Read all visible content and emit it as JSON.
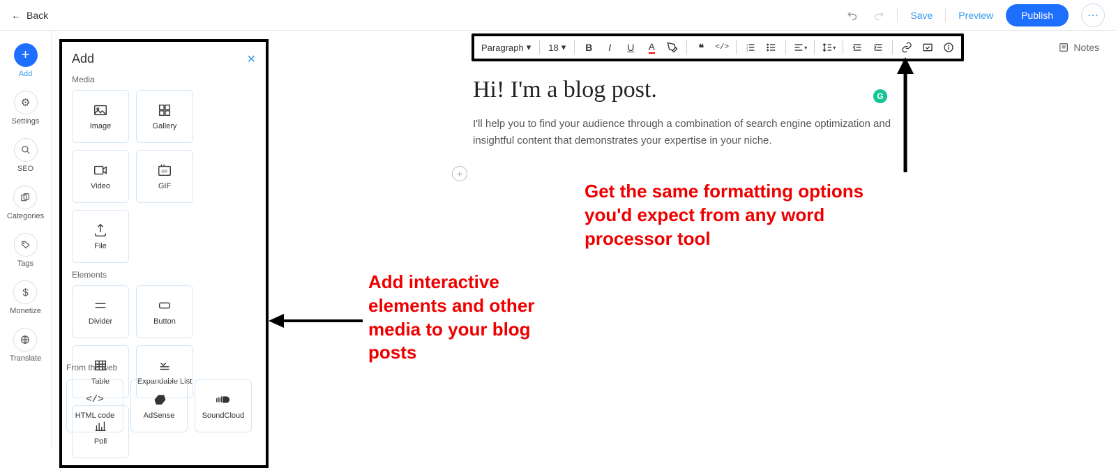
{
  "header": {
    "back_label": "Back",
    "undo_tooltip": "Undo",
    "redo_tooltip": "Redo",
    "save_label": "Save",
    "preview_label": "Preview",
    "publish_label": "Publish",
    "more_label": "..."
  },
  "sidebar": {
    "add_label": "Add",
    "items": [
      {
        "label": "Settings",
        "icon": "gear"
      },
      {
        "label": "SEO",
        "icon": "search"
      },
      {
        "label": "Categories",
        "icon": "cards"
      },
      {
        "label": "Tags",
        "icon": "tag"
      },
      {
        "label": "Monetize",
        "icon": "dollar"
      },
      {
        "label": "Translate",
        "icon": "globe"
      }
    ]
  },
  "add_panel": {
    "title": "Add",
    "sections": {
      "media": {
        "label": "Media",
        "items": [
          "Image",
          "Gallery",
          "Video",
          "GIF",
          "File"
        ]
      },
      "elements": {
        "label": "Elements",
        "items": [
          "Divider",
          "Button",
          "Table",
          "Expandable List",
          "Poll"
        ]
      },
      "web": {
        "label": "From the web",
        "items": [
          "HTML code",
          "AdSense",
          "SoundCloud"
        ]
      }
    }
  },
  "toolbar": {
    "style_label": "Paragraph",
    "font_size": "18",
    "buttons": [
      "bold",
      "italic",
      "underline",
      "text-color",
      "highlight",
      "quote",
      "code",
      "numbered-list",
      "bullet-list",
      "align",
      "line-height",
      "indent-decrease",
      "indent-increase",
      "link",
      "image-block",
      "info"
    ]
  },
  "post": {
    "title": "Hi! I'm a blog post.",
    "body": "I'll help you to find your audience through a combination of search engine optimization and insightful content that demonstrates your expertise in your niche."
  },
  "notes_label": "Notes",
  "annotations": {
    "left": "Add interactive elements and other media to your blog posts",
    "right": "Get the same formatting options you'd expect from any word processor tool"
  }
}
